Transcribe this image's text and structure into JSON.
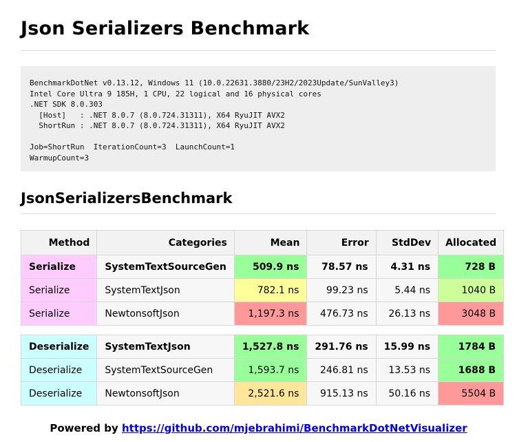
{
  "page": {
    "title": "Json Serializers Benchmark",
    "environment": "BenchmarkDotNet v0.13.12, Windows 11 (10.0.22631.3880/23H2/2023Update/SunValley3)\nIntel Core Ultra 9 185H, 1 CPU, 22 logical and 16 physical cores\n.NET SDK 8.0.303\n  [Host]   : .NET 8.0.7 (8.0.724.31311), X64 RyuJIT AVX2\n  ShortRun : .NET 8.0.7 (8.0.724.31311), X64 RyuJIT AVX2\n\nJob=ShortRun  IterationCount=3  LaunchCount=1\nWarmupCount=3",
    "section_title": "JsonSerializersBenchmark"
  },
  "table": {
    "headers": [
      "Method",
      "Categories",
      "Mean",
      "Error",
      "StdDev",
      "Allocated"
    ],
    "groups": [
      {
        "rows": [
          {
            "method": "Serialize",
            "category": "SystemTextSourceGen",
            "mean": "509.9 ns",
            "error": "78.57 ns",
            "stddev": "4.31 ns",
            "allocated": "728 B",
            "best": true
          },
          {
            "method": "Serialize",
            "category": "SystemTextJson",
            "mean": "782.1 ns",
            "error": "99.23 ns",
            "stddev": "5.44 ns",
            "allocated": "1040 B",
            "best": false
          },
          {
            "method": "Serialize",
            "category": "NewtonsoftJson",
            "mean": "1,197.3 ns",
            "error": "476.73 ns",
            "stddev": "26.13 ns",
            "allocated": "3048 B",
            "best": false
          }
        ]
      },
      {
        "rows": [
          {
            "method": "Deserialize",
            "category": "SystemTextJson",
            "mean": "1,527.8 ns",
            "error": "291.76 ns",
            "stddev": "15.99 ns",
            "allocated": "1784 B",
            "best": true
          },
          {
            "method": "Deserialize",
            "category": "SystemTextSourceGen",
            "mean": "1,593.7 ns",
            "error": "246.81 ns",
            "stddev": "13.53 ns",
            "allocated": "1688 B",
            "best": false
          },
          {
            "method": "Deserialize",
            "category": "NewtonsoftJson",
            "mean": "2,521.6 ns",
            "error": "915.13 ns",
            "stddev": "50.16 ns",
            "allocated": "5504 B",
            "best": false
          }
        ]
      }
    ]
  },
  "colors": {
    "serialize_method_bg": "#ffccff",
    "deserialize_method_bg": "#ccffff",
    "best_value_bg": "#99ff99",
    "good_value_bg": "#ccff99",
    "mid_value_bg": "#ffff99",
    "mid2_value_bg": "#ffe699",
    "worst_value_bg": "#ff9999",
    "link": "#0000ee"
  },
  "footer": {
    "prefix": "Powered by ",
    "link_text": "https://github.com/mjebrahimi/BenchmarkDotNetVisualizer"
  }
}
